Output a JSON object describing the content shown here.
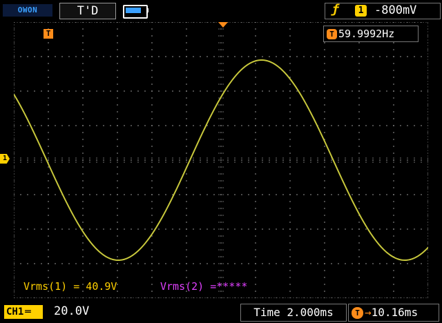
{
  "header": {
    "brand": "OWON",
    "trigger_status": "T'D",
    "battery_level": 0.8,
    "trigger_edge_icon": "rising-edge-icon",
    "trigger_channel": "1",
    "trigger_level": "-800mV"
  },
  "screen": {
    "trigger_position_marker": "T",
    "frequency_badge": "T",
    "frequency": "59.9992Hz",
    "ch1_ground_marker": "1",
    "waveform": {
      "channel": "CH1",
      "color": "#c8c83c",
      "amplitude_div": 2.9,
      "period_div": 8.3,
      "phase_div": -3.2
    }
  },
  "measurements": {
    "vrms1": "Vrms(1) = 40.9V",
    "vrms2": "Vrms(2) =*****"
  },
  "footer": {
    "channel": "CH1",
    "coupling_icon": "dc-coupling-icon",
    "volts_per_div": "20.0V",
    "timebase": "Time 2.000ms",
    "delay_badge": "T",
    "trigger_delay": "10.16ms"
  },
  "colors": {
    "ch1": "#ffd000",
    "ch2": "#e040ff",
    "trigger": "#ff8c1a",
    "grid": "#9a9a9a",
    "brand": "#3aa0ff"
  }
}
